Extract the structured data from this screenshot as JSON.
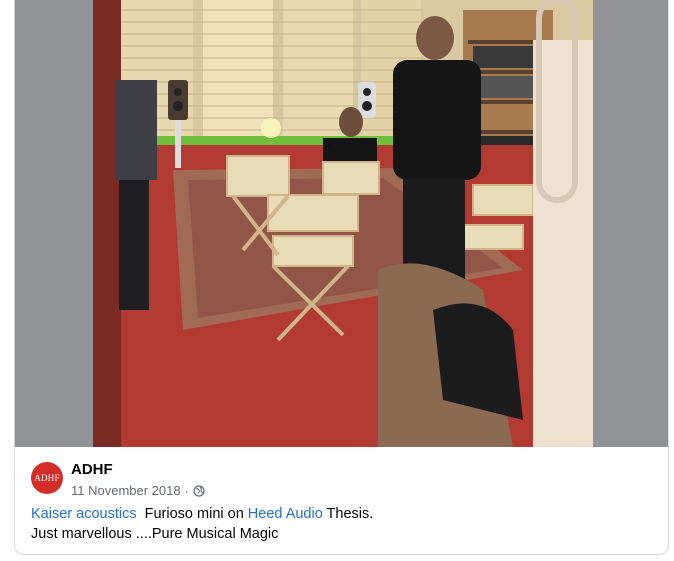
{
  "post": {
    "author": "ADHF",
    "avatar_text": "ADHF",
    "date": "11 November 2018",
    "separator": "·",
    "privacy_icon": "globe-icon",
    "text": {
      "link1": "Kaiser acoustics",
      "mid1": "  Furioso mini on ",
      "link2": "Heed Audio",
      "mid2": " Thesis.",
      "line2": "Just marvellous ....Pure Musical Magic"
    }
  },
  "colors": {
    "avatar_bg": "#d32d27",
    "link": "#1e6fd9",
    "media_bg": "#919396"
  }
}
